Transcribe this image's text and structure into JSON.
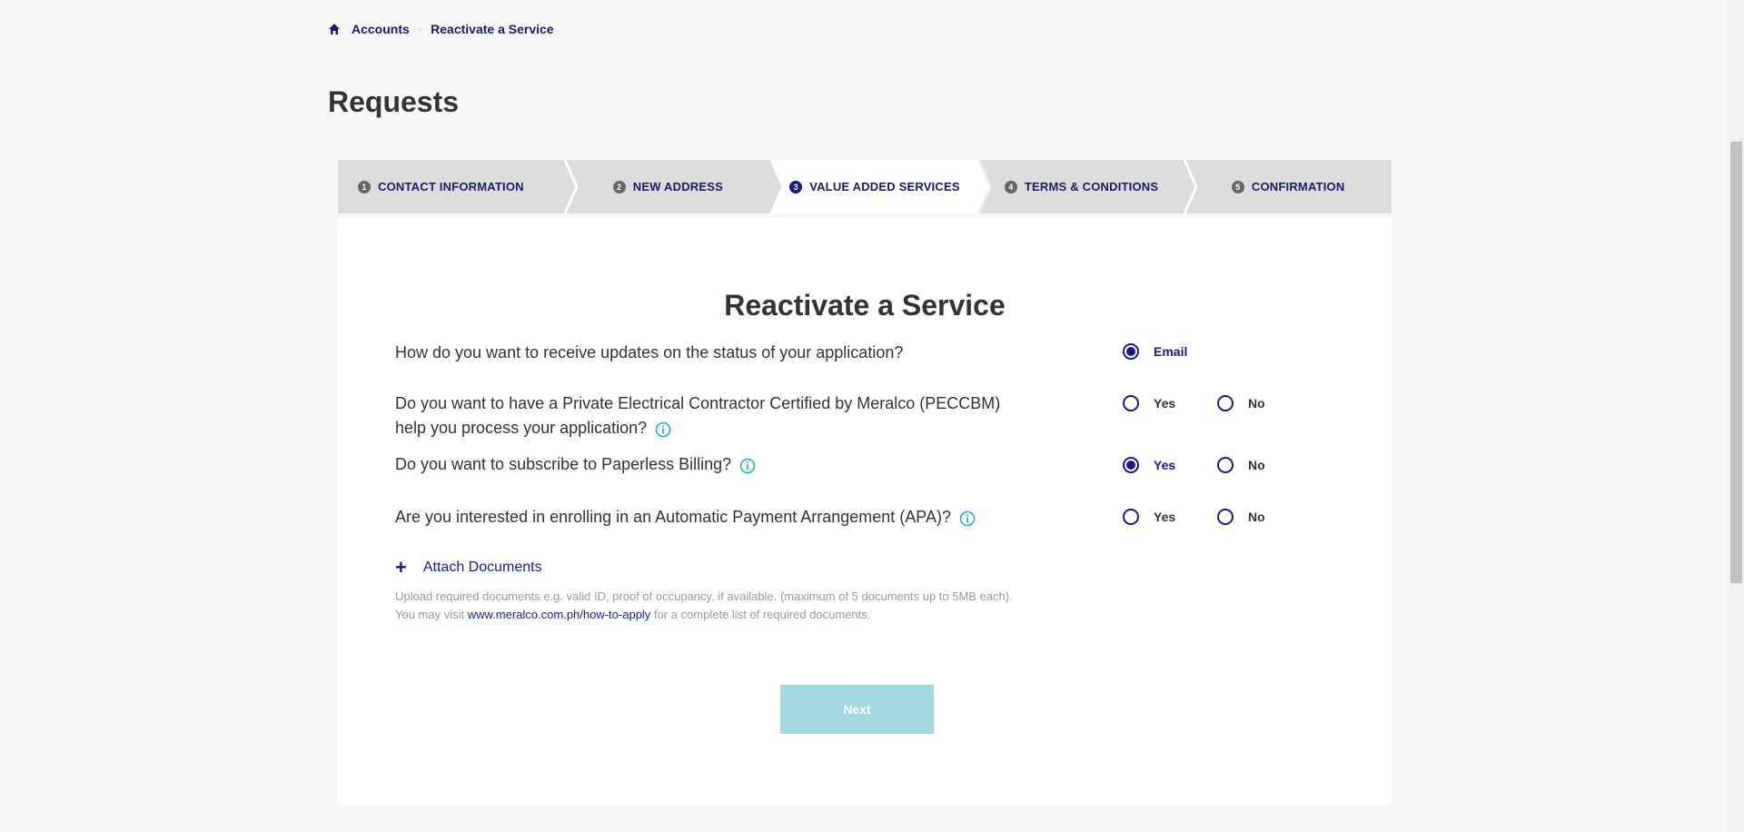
{
  "breadcrumb": {
    "home_icon": "home-icon",
    "items": [
      "Accounts",
      "Reactivate a Service"
    ]
  },
  "page_title": "Requests",
  "stepper": {
    "steps": [
      {
        "num": "1",
        "label": "CONTACT INFORMATION"
      },
      {
        "num": "2",
        "label": "NEW ADDRESS"
      },
      {
        "num": "3",
        "label": "VALUE ADDED SERVICES"
      },
      {
        "num": "4",
        "label": "TERMS & CONDITIONS"
      },
      {
        "num": "5",
        "label": "CONFIRMATION"
      }
    ],
    "active_index": 2
  },
  "form": {
    "title": "Reactivate a Service",
    "q1": {
      "text": "How do you want to receive updates on the status of your application?",
      "opt1": "Email"
    },
    "q2": {
      "line1": "Do you want to have a Private Electrical Contractor Certified by Meralco (PECCBM)",
      "line2": "help you process your application?",
      "yes": "Yes",
      "no": "No"
    },
    "q3": {
      "text": "Do you want to subscribe to Paperless Billing?",
      "yes": "Yes",
      "no": "No"
    },
    "q4": {
      "text": "Are you interested in enrolling in an Automatic Payment Arrangement (APA)?",
      "yes": "Yes",
      "no": "No"
    },
    "attach": {
      "label": "Attach Documents",
      "note_line1": "Upload required documents e.g. valid ID, proof of occupancy, if available. (maximum of 5 documents up to 5MB each).",
      "note_pre": "You may visit",
      "note_link": "www.meralco.com.ph/how-to-apply",
      "note_post": "for a complete list of required documents."
    },
    "next_label": "Next"
  },
  "colors": {
    "accent": "#1a1a8c",
    "info": "#1aaebf",
    "next_disabled": "#a1d9de"
  }
}
